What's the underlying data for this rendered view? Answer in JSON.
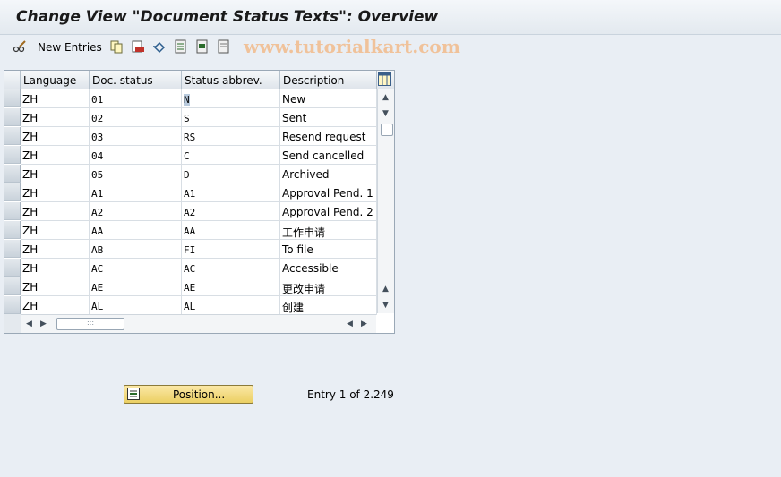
{
  "window": {
    "title": "Change View \"Document Status Texts\": Overview"
  },
  "toolbar": {
    "new_entries_label": "New Entries",
    "watermark": "www.tutorialkart.com",
    "icons": [
      "pencil-glasses-icon",
      "copy-icon",
      "delete-icon",
      "undo-icon",
      "select-all-icon",
      "select-block-icon",
      "deselect-all-icon"
    ]
  },
  "table": {
    "columns": [
      "Language",
      "Doc. status",
      "Status abbrev.",
      "Description"
    ],
    "rows": [
      [
        "ZH",
        "01",
        "N",
        "New"
      ],
      [
        "ZH",
        "02",
        "S",
        "Sent"
      ],
      [
        "ZH",
        "03",
        "RS",
        "Resend request"
      ],
      [
        "ZH",
        "04",
        "C",
        "Send cancelled"
      ],
      [
        "ZH",
        "05",
        "D",
        "Archived"
      ],
      [
        "ZH",
        "A1",
        "A1",
        "Approval Pend. 1"
      ],
      [
        "ZH",
        "A2",
        "A2",
        "Approval Pend. 2"
      ],
      [
        "ZH",
        "AA",
        "AA",
        "工作申请"
      ],
      [
        "ZH",
        "AB",
        "FI",
        "To file"
      ],
      [
        "ZH",
        "AC",
        "AC",
        "Accessible"
      ],
      [
        "ZH",
        "AE",
        "AE",
        "更改申请"
      ],
      [
        "ZH",
        "AL",
        "AL",
        "创建"
      ]
    ]
  },
  "footer": {
    "position_button": "Position...",
    "entry_info": "Entry 1 of 2.249"
  }
}
